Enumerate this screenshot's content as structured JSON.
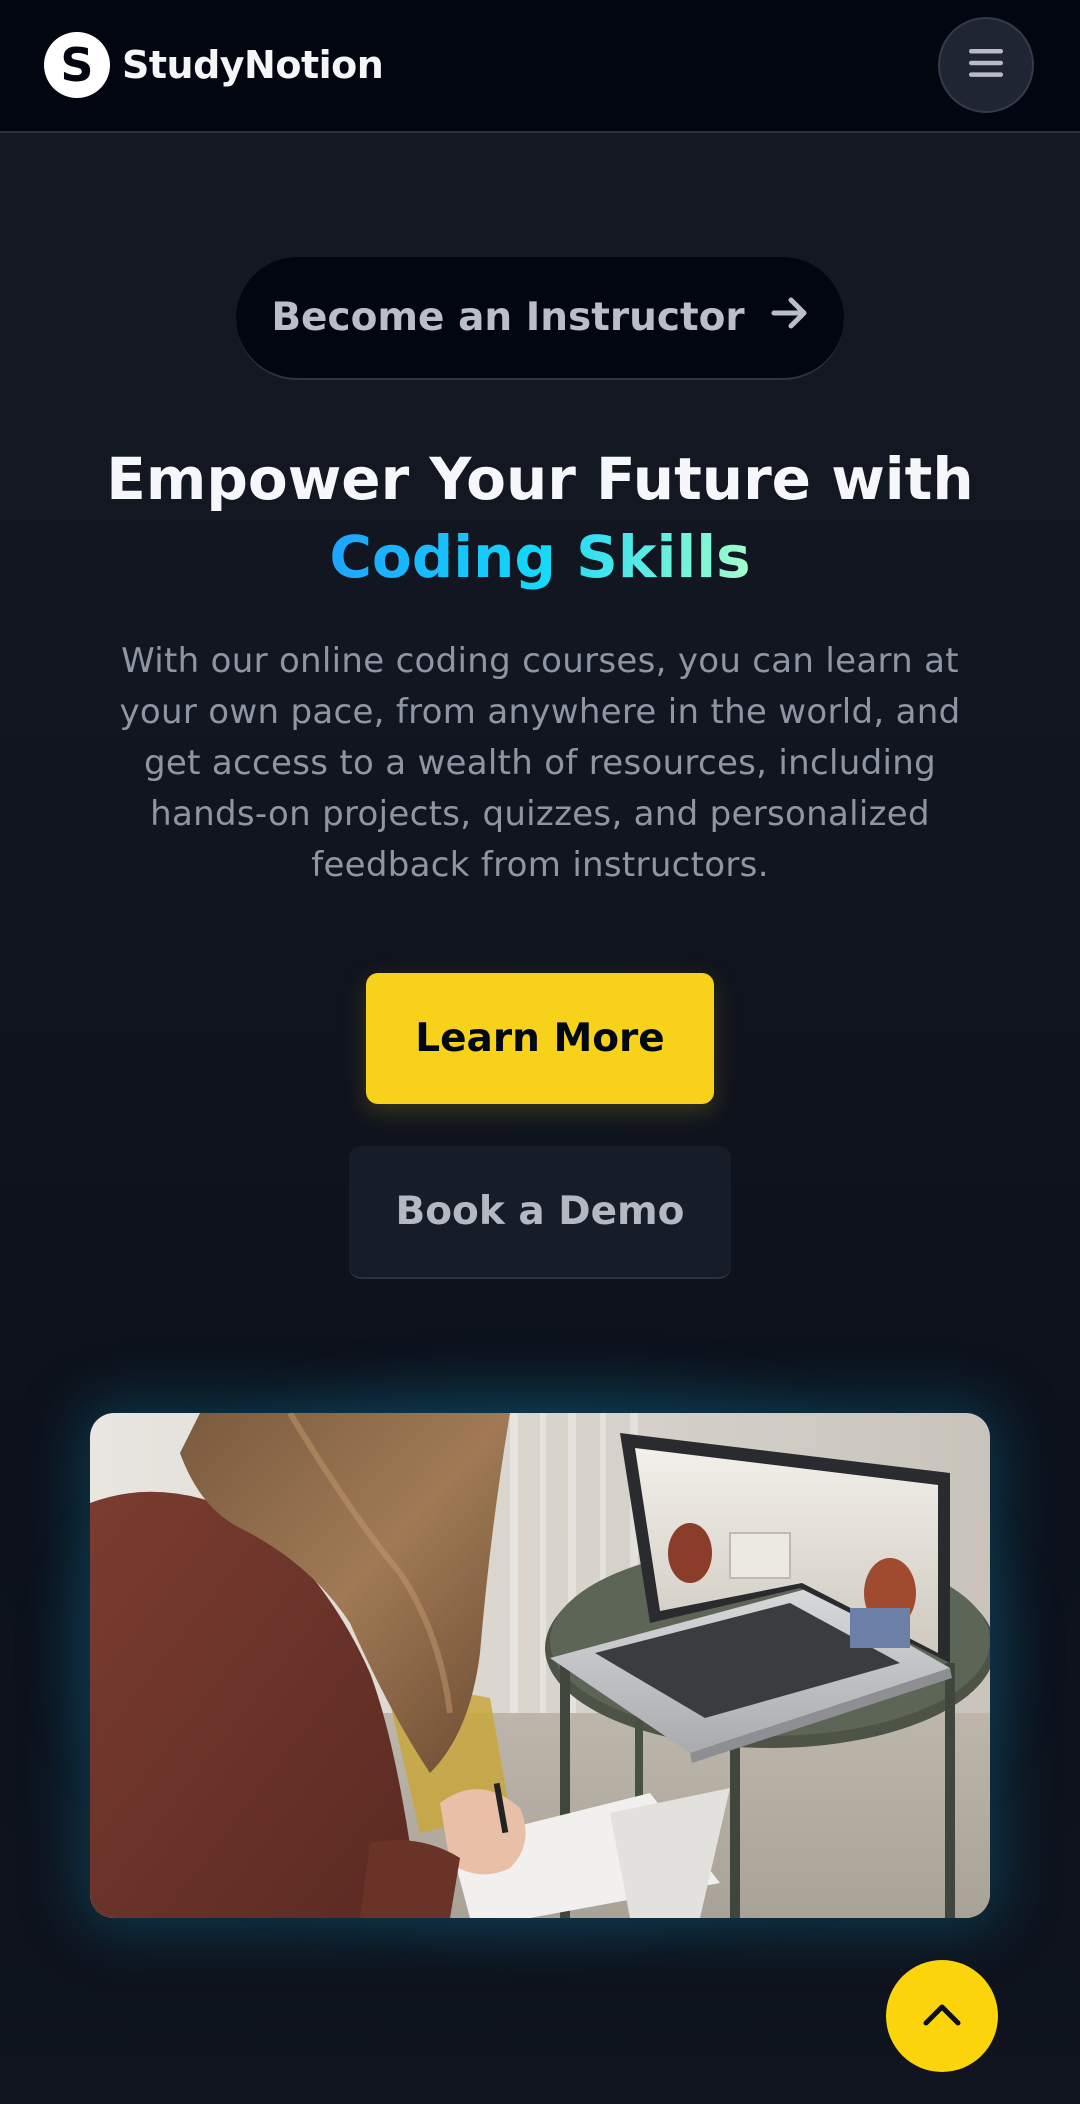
{
  "header": {
    "brand": "StudyNotion",
    "logo_icon": "s-logo-icon",
    "menu_icon": "hamburger-menu-icon"
  },
  "hero": {
    "instructor_cta": "Become an Instructor",
    "instructor_cta_icon": "arrow-right-icon",
    "headline_prefix": "Empower Your Future with",
    "headline_accent": "Coding Skills",
    "description": "With our online coding courses, you can learn at your own pace, from anywhere in the world, and get access to a wealth of resources, including hands-on projects, quizzes, and personalized feedback from instructors.",
    "primary_button": "Learn More",
    "secondary_button": "Book a Demo"
  },
  "media": {
    "image_subject": "student-with-laptop-photo"
  },
  "floating": {
    "scroll_top_icon": "chevron-up-icon"
  },
  "colors": {
    "accent_yellow": "#f8d11a",
    "accent_gradient_start": "#1fa2ff",
    "accent_gradient_end": "#a6ffcb",
    "header_bg": "#020611",
    "page_bg": "#10141e"
  }
}
